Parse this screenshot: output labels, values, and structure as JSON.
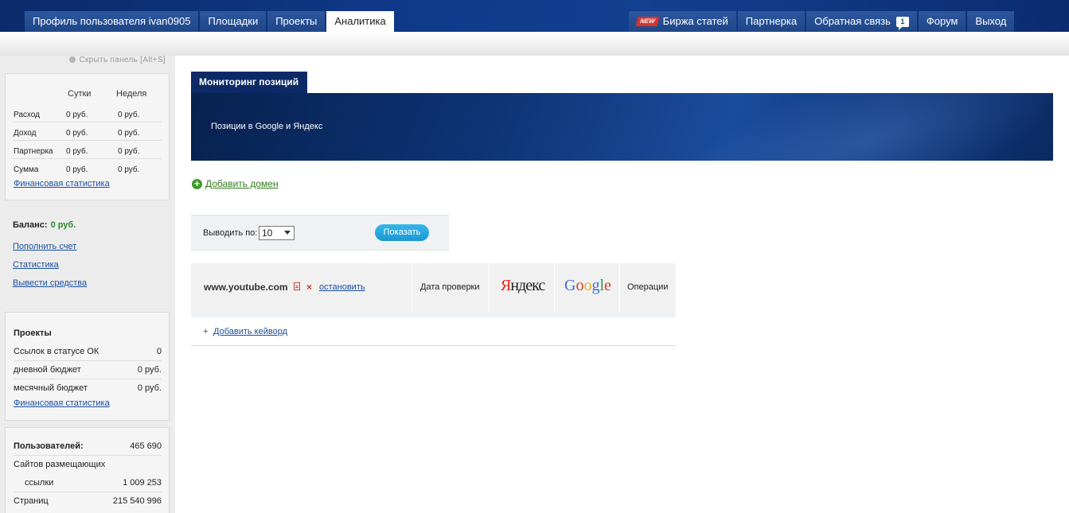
{
  "nav_left": [
    {
      "label": "Профиль пользователя ivan0905",
      "active": false
    },
    {
      "label": "Площадки",
      "active": false
    },
    {
      "label": "Проекты",
      "active": false
    },
    {
      "label": "Аналитика",
      "active": true
    }
  ],
  "nav_right": {
    "exchange_badge": "NEW",
    "exchange": "Биржа статей",
    "partner": "Партнерка",
    "feedback": "Обратная связь",
    "feedback_count": "1",
    "forum": "Форум",
    "logout": "Выход"
  },
  "sidebar": {
    "hide_panel": "Скрыть панель [Alt+S]",
    "finance": {
      "col_day": "Сутки",
      "col_week": "Неделя",
      "rows": [
        {
          "label": "Расход",
          "day": "0 руб.",
          "week": "0 руб."
        },
        {
          "label": "Доход",
          "day": "0 руб.",
          "week": "0 руб."
        },
        {
          "label": "Партнерка",
          "day": "0 руб.",
          "week": "0 руб."
        },
        {
          "label": "Сумма",
          "day": "0 руб.",
          "week": "0 руб."
        }
      ],
      "link": "Финансовая статистика"
    },
    "balance_label": "Баланс:",
    "balance_value": "0 руб.",
    "links": [
      "Пополнить счет",
      "Статистика",
      "Вывести средства"
    ],
    "projects": {
      "title": "Проекты",
      "rows": [
        {
          "label": "Ссылок в статусе ОК",
          "value": "0"
        },
        {
          "label": "дневной бюджет",
          "value": "0 руб."
        },
        {
          "label": "месячный бюджет",
          "value": "0 руб."
        }
      ],
      "link": "Финансовая статистика"
    },
    "stats": {
      "users_label": "Пользователей:",
      "users_value": "465 690",
      "sites_label": "Сайтов размещающих",
      "links_label": "ссылки",
      "links_value": "1 009 253",
      "pages_label": "Страниц",
      "pages_value": "215 540 996"
    }
  },
  "main": {
    "tab": "Мониторинг позиций",
    "banner_text": "Позиции в Google и Яндекс",
    "add_domain": "Добавить домен",
    "filter": {
      "label": "Выводить по:",
      "per_page": "10",
      "show_button": "Показать"
    },
    "table": {
      "domain": "www.youtube.com",
      "stop": "остановить",
      "date_col": "Дата проверки",
      "yandex_first": "Я",
      "yandex_rest": "ндекс",
      "ops_col": "Операции"
    },
    "add_keyword": "Добавить кейворд"
  },
  "colors": {
    "nav_bg": "#0e3a8a",
    "accent_green": "#2a8a2a",
    "button_blue": "#1a98d2",
    "link_blue": "#1a4fa0"
  }
}
